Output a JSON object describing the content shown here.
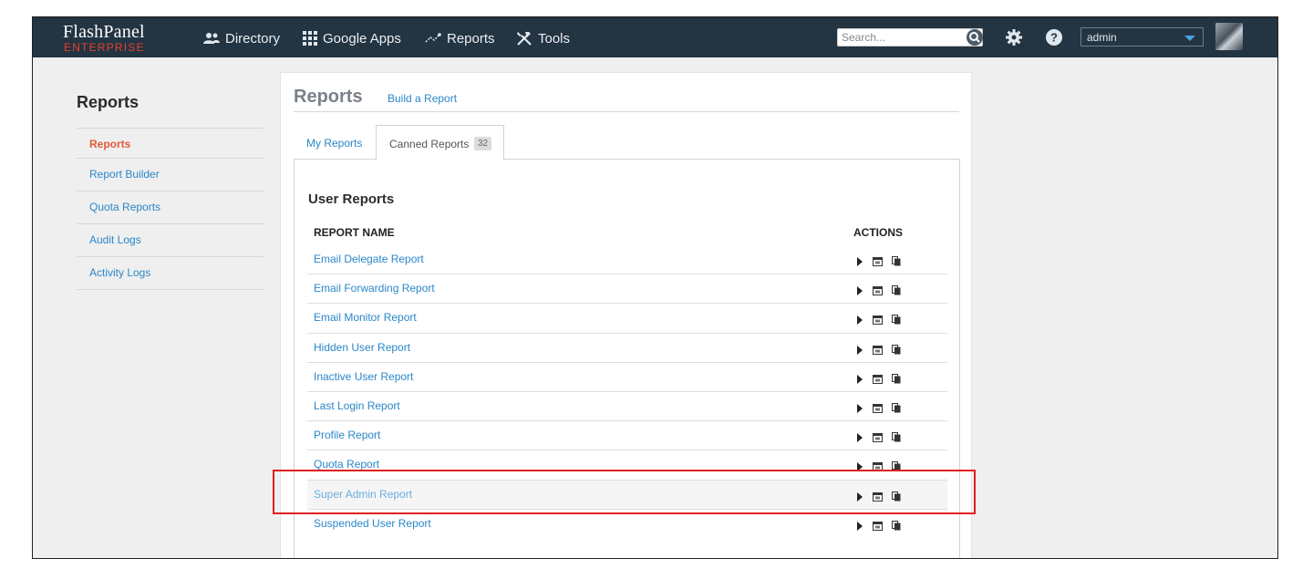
{
  "header": {
    "logo_main": "FlashPanel",
    "logo_sub": "ENTERPRISE",
    "nav": [
      {
        "label": "Directory",
        "icon": "users-icon"
      },
      {
        "label": "Google Apps",
        "icon": "grid-icon"
      },
      {
        "label": "Reports",
        "icon": "chart-line-icon"
      },
      {
        "label": "Tools",
        "icon": "tools-icon"
      }
    ],
    "search_placeholder": "Search...",
    "user_select_value": "admin"
  },
  "sidebar": {
    "title": "Reports",
    "items": [
      {
        "label": "Reports",
        "active": true
      },
      {
        "label": "Report Builder"
      },
      {
        "label": "Quota Reports"
      },
      {
        "label": "Audit Logs"
      },
      {
        "label": "Activity Logs"
      }
    ]
  },
  "main": {
    "title": "Reports",
    "build_link": "Build a Report",
    "tabs": [
      {
        "label": "My Reports"
      },
      {
        "label": "Canned Reports",
        "count": "32",
        "active": true
      }
    ],
    "section_title": "User Reports",
    "columns": {
      "name": "REPORT NAME",
      "actions": "ACTIONS"
    },
    "reports": [
      {
        "name": "Email Delegate Report"
      },
      {
        "name": "Email Forwarding Report"
      },
      {
        "name": "Email Monitor Report"
      },
      {
        "name": "Hidden User Report"
      },
      {
        "name": "Inactive User Report"
      },
      {
        "name": "Last Login Report"
      },
      {
        "name": "Profile Report"
      },
      {
        "name": "Quota Report"
      },
      {
        "name": "Super Admin Report",
        "hovered": true
      },
      {
        "name": "Suspended User Report"
      }
    ]
  },
  "colors": {
    "topbar": "#233442",
    "link": "#2a87c9",
    "active_nav": "#e05a37",
    "highlight": "#e01f1f"
  }
}
